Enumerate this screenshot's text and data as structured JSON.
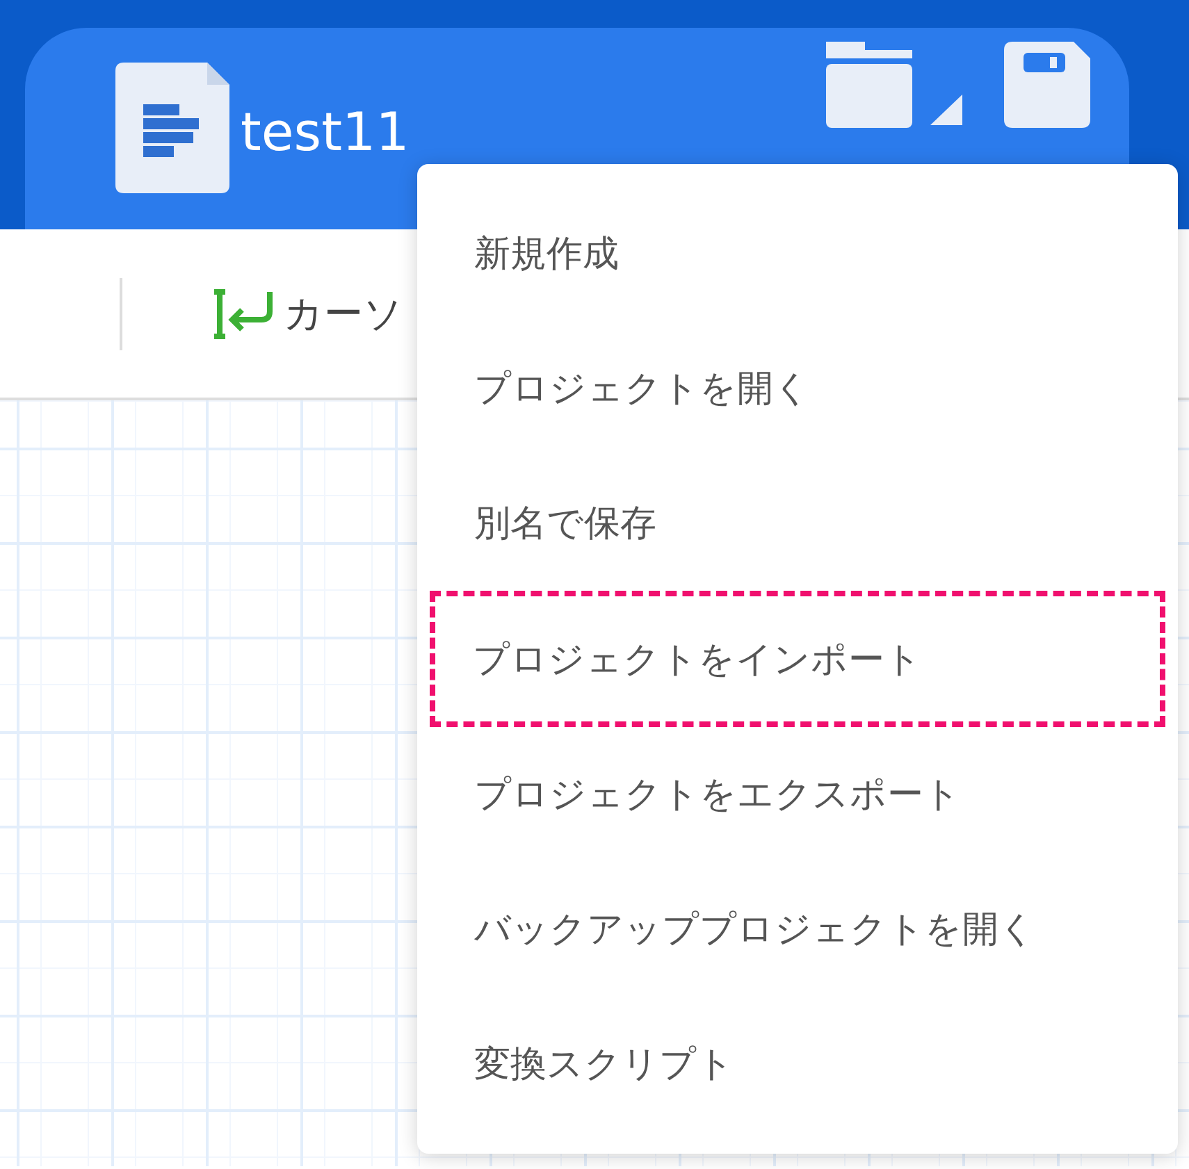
{
  "document": {
    "title": "test11"
  },
  "header_buttons": [
    {
      "kind": "folder"
    },
    {
      "kind": "save"
    }
  ],
  "toolbar": [
    {
      "kind": "cursor",
      "label": "カーソ"
    }
  ],
  "menu": {
    "items": [
      {
        "label": "新規作成",
        "highlighted": false
      },
      {
        "label": "プロジェクトを開く",
        "highlighted": false
      },
      {
        "label": "別名で保存",
        "highlighted": false
      },
      {
        "label": "プロジェクトをインポート",
        "highlighted": true
      },
      {
        "label": "プロジェクトをエクスポート",
        "highlighted": false
      },
      {
        "label": "バックアッププロジェクトを開く",
        "highlighted": false
      },
      {
        "label": "変換スクリプト",
        "highlighted": false
      }
    ]
  }
}
